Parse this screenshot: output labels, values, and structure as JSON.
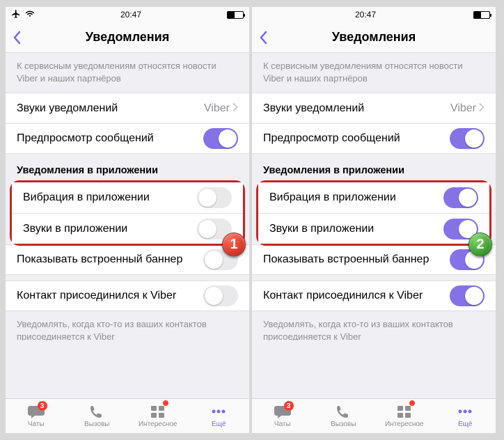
{
  "statusbar": {
    "time": "20:47"
  },
  "nav": {
    "title": "Уведомления"
  },
  "service_note": "К сервисным уведомлениям относятся новости Viber и наших партнёров",
  "rows": {
    "notif_sounds_label": "Звуки уведомлений",
    "notif_sounds_value": "Viber",
    "preview_label": "Предпросмотр сообщений",
    "inapp_header": "Уведомления в приложении",
    "inapp_vibrate": "Вибрация в приложении",
    "inapp_sounds": "Звуки в приложении",
    "builtin_banner": "Показывать встроенный баннер",
    "contact_joined": "Контакт присоединился к Viber",
    "contact_joined_note": "Уведомлять, когда кто-то из ваших контактов присоединяется к Viber"
  },
  "tabs": {
    "chats": "Чаты",
    "calls": "Вызовы",
    "interesting": "Интересное",
    "more": "Ещё",
    "chat_badge": "3"
  },
  "steps": {
    "one": "1",
    "two": "2"
  }
}
